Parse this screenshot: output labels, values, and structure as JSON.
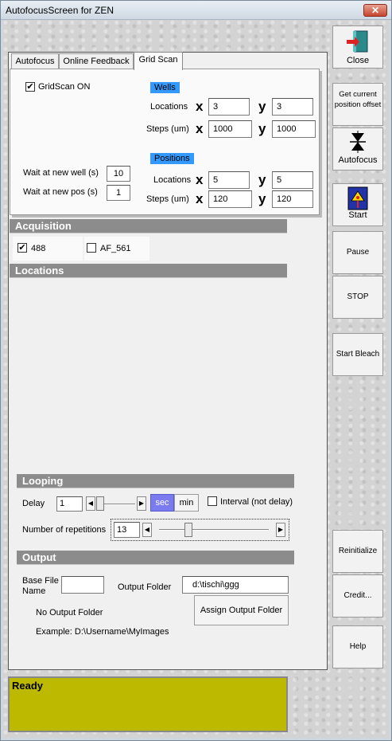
{
  "window": {
    "title": "AutofocusScreen for ZEN",
    "close_glyph": "✕"
  },
  "tabs": [
    {
      "label": "Autofocus"
    },
    {
      "label": "Online Feedback"
    },
    {
      "label": "Grid Scan",
      "active": true
    }
  ],
  "gridscan": {
    "enabled_label": "GridScan ON",
    "enabled": true,
    "wells_label": "Wells",
    "locations_label": "Locations",
    "steps_label": "Steps (um)",
    "x_label": "x",
    "y_label": "y",
    "wells_locations_x": "3",
    "wells_locations_y": "3",
    "wells_steps_x": "1000",
    "wells_steps_y": "1000",
    "positions_label": "Positions",
    "positions_locations_x": "5",
    "positions_locations_y": "5",
    "positions_steps_x": "120",
    "positions_steps_y": "120",
    "wait_well_label": "Wait at new well (s)",
    "wait_well_value": "10",
    "wait_pos_label": "Wait at new pos (s)",
    "wait_pos_value": "1"
  },
  "acquisition": {
    "title": "Acquisition",
    "channels": [
      {
        "label": "488",
        "checked": true
      },
      {
        "label": "AF_561",
        "checked": false
      }
    ]
  },
  "locations": {
    "title": "Locations"
  },
  "looping": {
    "title": "Looping",
    "delay_label": "Delay",
    "delay_value": "1",
    "sec_label": "sec",
    "min_label": "min",
    "interval_label": "Interval (not delay)",
    "repetitions_label": "Number of repetitions",
    "repetitions_value": "13"
  },
  "output": {
    "title": "Output",
    "base_file_label": "Base File Name",
    "base_file_value": "",
    "output_folder_label": "Output Folder",
    "output_folder_value": "d:\\tischi\\ggg",
    "no_output_text": "No Output Folder",
    "assign_button": "Assign Output Folder",
    "example_text": "Example: D:\\Username\\MyImages"
  },
  "sidebar": {
    "close": "Close",
    "get_offset": "Get current position offset",
    "autofocus": "Autofocus",
    "start": "Start",
    "pause": "Pause",
    "stop": "STOP",
    "start_bleach": "Start Bleach",
    "reinitialize": "Reinitialize",
    "credit": "Credit...",
    "help": "Help"
  },
  "status": {
    "text": "Ready",
    "color": "#bcb900"
  },
  "colors": {
    "accent_blue": "#3399ff",
    "sec_selected": "#7b7bf0",
    "section_bar": "#8c8c8c"
  }
}
